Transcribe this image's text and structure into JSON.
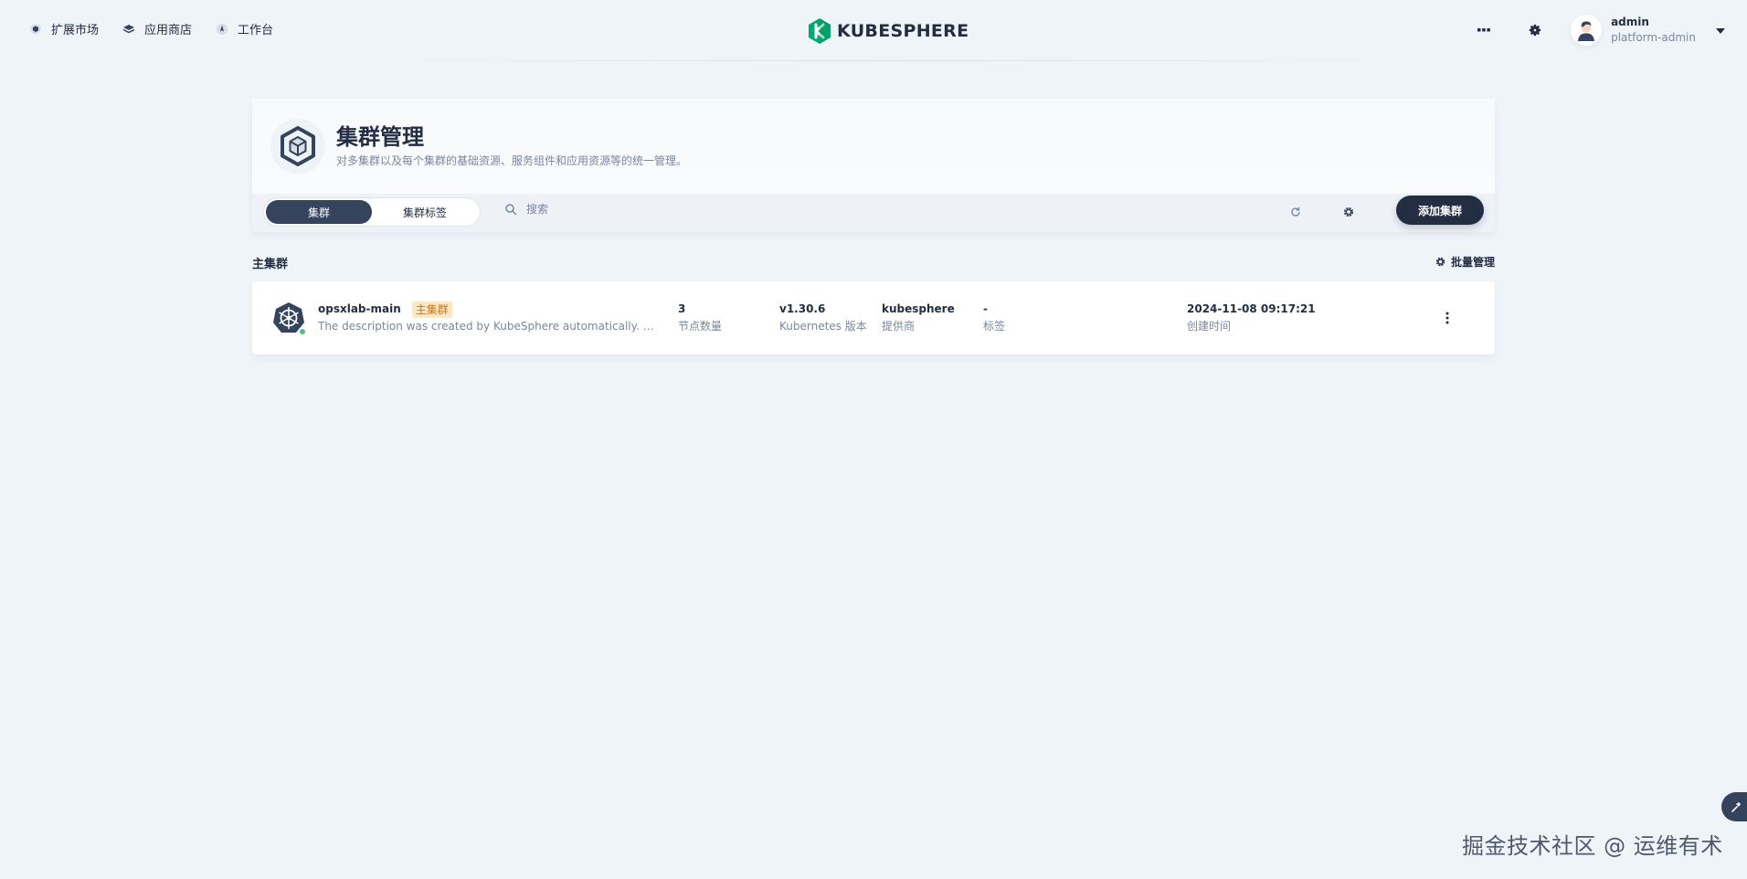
{
  "topnav": {
    "links": [
      {
        "label": "扩展市场",
        "icon": "extensions-icon"
      },
      {
        "label": "应用商店",
        "icon": "app-store-icon"
      },
      {
        "label": "工作台",
        "icon": "workbench-icon"
      }
    ],
    "brand": "KUBESPHERE",
    "user": {
      "name": "admin",
      "role": "platform-admin"
    }
  },
  "banner": {
    "title": "集群管理",
    "description": "对多集群以及每个集群的基础资源、服务组件和应用资源等的统一管理。",
    "tabs": [
      {
        "label": "集群",
        "active": true
      },
      {
        "label": "集群标签",
        "active": false
      }
    ],
    "search_placeholder": "搜索",
    "add_button": "添加集群"
  },
  "section": {
    "title": "主集群",
    "batch_label": "批量管理"
  },
  "clusters": [
    {
      "name": "opsxlab-main",
      "badge": "主集群",
      "description": "The description was created by KubeSphere automatically. It is reco...",
      "status": "running",
      "node_count": "3",
      "node_count_label": "节点数量",
      "k8s_version": "v1.30.6",
      "k8s_version_label": "Kubernetes 版本",
      "provider": "kubesphere",
      "provider_label": "提供商",
      "tags": "-",
      "tags_label": "标签",
      "created": "2024-11-08 09:17:21",
      "created_label": "创建时间"
    }
  ],
  "watermark": "掘金技术社区 @ 运维有术",
  "colors": {
    "background": "#eff4f9",
    "primary_dark": "#242e42",
    "tab_active": "#36435c",
    "brand_green": "#00a971",
    "badge_bg": "#ffe7c2",
    "badge_text": "#c7761a",
    "status_ok": "#55bc8a",
    "muted_text": "#79879c"
  }
}
